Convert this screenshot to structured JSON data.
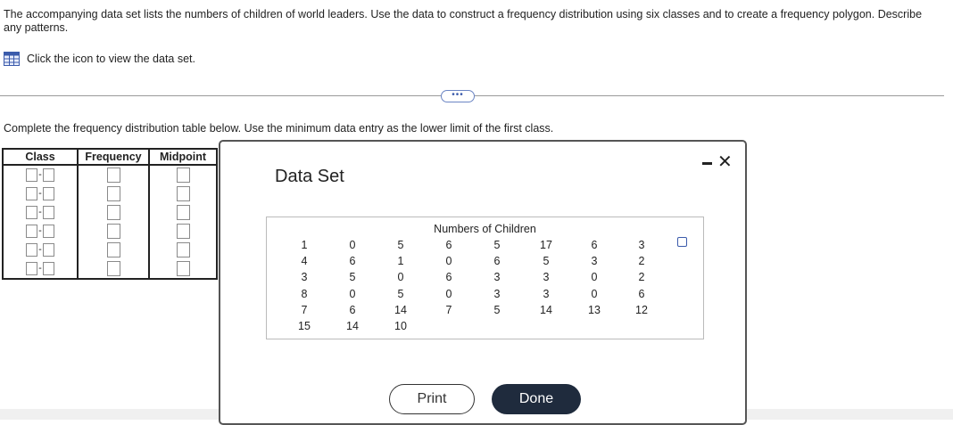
{
  "question": {
    "text": "The accompanying data set lists the numbers of children of world leaders. Use the data to construct a frequency distribution using six classes and to create a frequency polygon. Describe any patterns."
  },
  "dataset_link": {
    "label": "Click the icon to view the data set.",
    "icon": "table-icon"
  },
  "more_button": {
    "label": "•••"
  },
  "instruction": {
    "text": "Complete the frequency distribution table below. Use the minimum data entry as the lower limit of the first class."
  },
  "freq_table": {
    "headers": [
      "Class",
      "Frequency",
      "Midpoint"
    ],
    "row_count": 6
  },
  "modal": {
    "title": "Data Set",
    "data_title": "Numbers of Children",
    "columns": [
      [
        "1",
        "4",
        "3",
        "8",
        "7",
        "15"
      ],
      [
        "0",
        "6",
        "5",
        "0",
        "6",
        "14"
      ],
      [
        "5",
        "1",
        "0",
        "5",
        "14",
        "10"
      ],
      [
        "6",
        "0",
        "6",
        "0",
        "7"
      ],
      [
        "5",
        "6",
        "3",
        "3",
        "5"
      ],
      [
        "17",
        "5",
        "3",
        "3",
        "14"
      ],
      [
        "6",
        "3",
        "0",
        "0",
        "13"
      ],
      [
        "3",
        "2",
        "2",
        "6",
        "12"
      ]
    ],
    "print_label": "Print",
    "done_label": "Done"
  }
}
